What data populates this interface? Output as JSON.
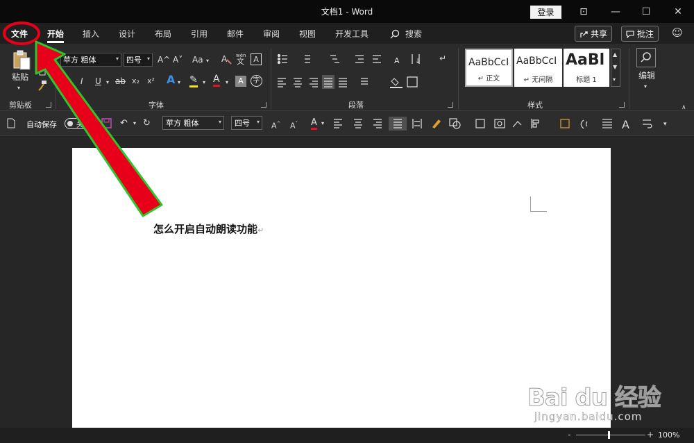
{
  "window": {
    "title": "文档1  -  Word",
    "login": "登录",
    "minimize": "—",
    "maximize": "☐",
    "close": "✕",
    "ribbon_display": "⊡"
  },
  "tabs": [
    {
      "label": "文件"
    },
    {
      "label": "开始"
    },
    {
      "label": "插入"
    },
    {
      "label": "设计"
    },
    {
      "label": "布局"
    },
    {
      "label": "引用"
    },
    {
      "label": "邮件"
    },
    {
      "label": "审阅"
    },
    {
      "label": "视图"
    },
    {
      "label": "开发工具"
    }
  ],
  "search": {
    "label": "搜索"
  },
  "share": {
    "label": "共享"
  },
  "comments": {
    "label": "批注"
  },
  "ribbon": {
    "clipboard": {
      "paste": "粘贴",
      "label": "剪贴板"
    },
    "font": {
      "name": "苹方 粗体",
      "size": "四号",
      "label": "字体",
      "grow": "A^",
      "shrink": "A˅",
      "case": "Aa",
      "phonetic_top": "wén",
      "phonetic_bottom": "文",
      "border_char": "A",
      "bold": "B",
      "italic": "I",
      "underline": "U",
      "strike": "ab",
      "sub": "x₂",
      "sup": "x²",
      "effects": "A",
      "highlight": "✎",
      "color": "A",
      "shade": "A",
      "circle": "字"
    },
    "paragraph": {
      "label": "段落"
    },
    "styles": {
      "label": "样式",
      "items": [
        {
          "sample": "AaBbCcI",
          "name": "↵ 正文"
        },
        {
          "sample": "AaBbCcI",
          "name": "↵ 无间隔"
        },
        {
          "sample": "AaBl",
          "name": "标题 1"
        }
      ]
    },
    "editing": {
      "label": "编辑"
    }
  },
  "qat": {
    "autosave": "自动保存",
    "toggle_state": "关",
    "font": "苹方 粗体",
    "size": "四号"
  },
  "document": {
    "text": "怎么开启自动朗读功能",
    "para_mark": "↵"
  },
  "status": {
    "zoom": "100%",
    "minus": "-",
    "plus": "+"
  },
  "watermark": {
    "big": "Bai du 经验",
    "small": "jingyan.baidu.com"
  },
  "colors": {
    "accent_red": "#e8001a",
    "arrow_green": "#2ec42e",
    "highlight_yellow": "#f5e50a",
    "font_red": "#e81123"
  }
}
